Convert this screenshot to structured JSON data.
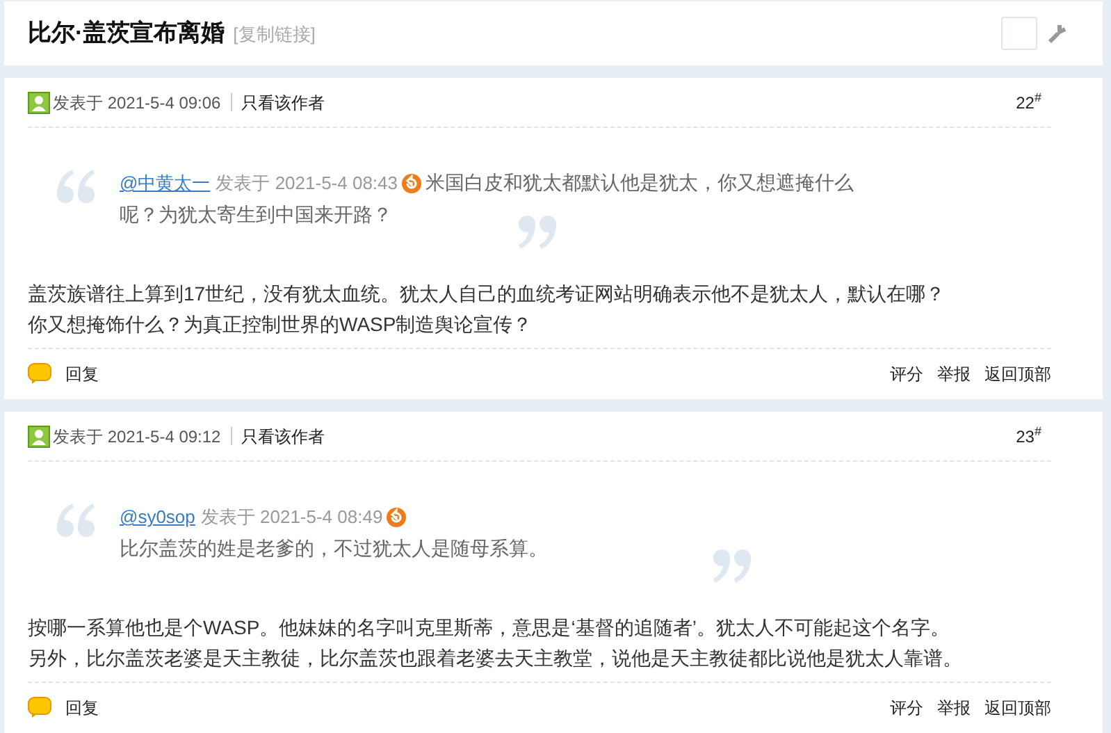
{
  "header": {
    "title": "比尔·盖茨宣布离婚",
    "copy_link": "[复制链接]"
  },
  "posts": [
    {
      "posted": "发表于 2021-5-4 09:06",
      "author_only": "只看该作者",
      "floor": "22$^{#}$",
      "quote": {
        "user": "@中黄太一",
        "meta": "发表于 2021-5-4 08:43",
        "first_line_inline": true,
        "lines": [
          "米国白皮和犹太都默认他是犹太，你又想遮掩什么",
          "呢？为犹太寄生到中国来开路？"
        ]
      },
      "body": [
        "盖茨族谱往上算到17世纪，没有犹太血统。犹太人自己的血统考证网站明确表示他不是犹太人，默认在哪？",
        "你又想掩饰什么？为真正控制世界的WASP制造舆论宣传？"
      ],
      "reply": "回复",
      "actions": [
        "评分",
        "举报",
        "返回顶部"
      ]
    },
    {
      "posted": "发表于 2021-5-4 09:12",
      "author_only": "只看该作者",
      "floor": "23$^{#}$",
      "quote": {
        "user": "@sy0sop",
        "meta": "发表于 2021-5-4 08:49",
        "first_line_inline": false,
        "lines": [
          "比尔盖茨的姓是老爹的，不过犹太人是随母系算。"
        ]
      },
      "body": [
        "按哪一系算他也是个WASP。他妹妹的名字叫克里斯蒂，意思是‘基督的追随者’。犹太人不可能起这个名字。",
        "另外，比尔盖茨老婆是天主教徒，比尔盖茨也跟着老婆去天主教堂，说他是天主教徒都比说他是犹太人靠谱。"
      ],
      "reply": "回复",
      "actions": [
        "评分",
        "举报",
        "返回顶部"
      ]
    }
  ]
}
